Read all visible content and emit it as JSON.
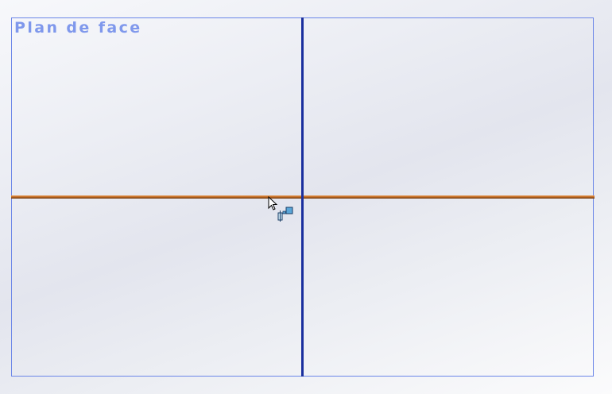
{
  "viewport": {
    "plane_label": "Plan de face"
  },
  "cursor": {
    "icon": "pointer-with-coincident-relation-icon"
  },
  "colors": {
    "frame": "#6b86e8",
    "label": "#7f98ec",
    "vertical_axis": "#1a2f9e",
    "horizontal_axis": "#c36a1e"
  }
}
